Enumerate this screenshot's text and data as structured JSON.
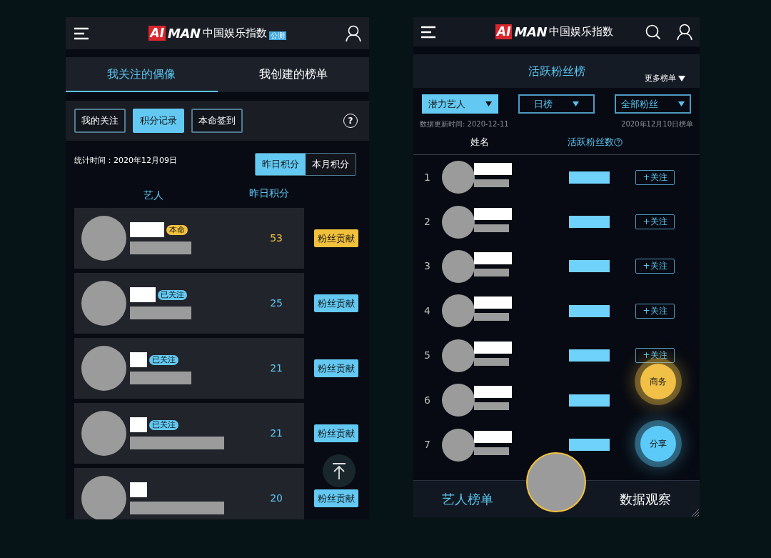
{
  "left": {
    "logo": {
      "mark": "AI",
      "brand": "MAN",
      "title": "中国娱乐指数",
      "badge": "公测"
    },
    "tabs": [
      {
        "label": "我关注的偶像",
        "selected": true
      },
      {
        "label": "我创建的榜单",
        "selected": false
      }
    ],
    "filters": [
      {
        "label": "我的关注",
        "selected": false
      },
      {
        "label": "积分记录",
        "selected": true
      },
      {
        "label": "本命签到",
        "selected": false
      }
    ],
    "help": "?",
    "stat_time": "统计时间：2020年12月09日",
    "periods": [
      {
        "label": "昨日积分",
        "selected": true
      },
      {
        "label": "本月积分",
        "selected": false
      }
    ],
    "columns": [
      "艺人",
      "昨日积分"
    ],
    "rows": [
      {
        "badge": {
          "text": "本命",
          "kind": "favorite"
        },
        "score": "53",
        "highlighted": true,
        "action": "粉丝贡献"
      },
      {
        "badge": {
          "text": "已关注",
          "kind": "followed"
        },
        "score": "25",
        "highlighted": false,
        "action": "粉丝贡献"
      },
      {
        "badge": {
          "text": "已关注",
          "kind": "followed"
        },
        "score": "21",
        "highlighted": false,
        "action": "粉丝贡献"
      },
      {
        "badge": {
          "text": "已关注",
          "kind": "followed"
        },
        "score": "21",
        "highlighted": false,
        "action": "粉丝贡献"
      },
      {
        "score": "20",
        "highlighted": false,
        "action": "粉丝贡献"
      }
    ]
  },
  "right": {
    "logo": {
      "mark": "AI",
      "brand": "MAN",
      "title": "中国娱乐指数"
    },
    "title": "活跃粉丝榜",
    "more": "更多榜单",
    "dropdowns": [
      {
        "label": "潜力艺人",
        "selected": true
      },
      {
        "label": "日榜",
        "selected": false
      },
      {
        "label": "全部粉丝",
        "selected": false
      }
    ],
    "updated": "数据更新时间: 2020-12-11",
    "list_date": "2020年12月10日榜单",
    "columns": [
      "姓名",
      "活跃粉丝数"
    ],
    "rows": [
      {
        "rank": "1",
        "follow": "+关注"
      },
      {
        "rank": "2",
        "follow": "+关注"
      },
      {
        "rank": "3",
        "follow": "+关注"
      },
      {
        "rank": "4",
        "follow": "+关注"
      },
      {
        "rank": "5",
        "follow": "+关注"
      },
      {
        "rank": "6"
      },
      {
        "rank": "7"
      }
    ],
    "fabs": [
      {
        "label": "商务",
        "kind": "business"
      },
      {
        "label": "分享",
        "kind": "share"
      }
    ],
    "nav": [
      {
        "label": "艺人榜单",
        "selected": true
      },
      {
        "label": "数据观察",
        "selected": false
      }
    ]
  }
}
